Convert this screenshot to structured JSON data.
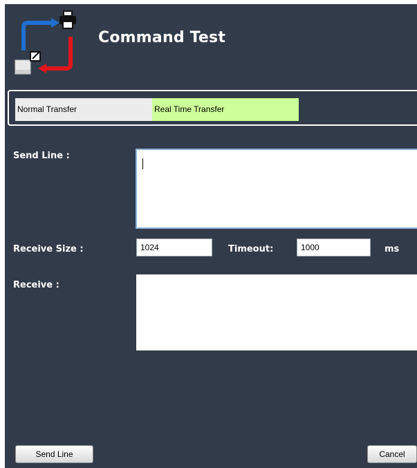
{
  "header": {
    "title": "Command Test",
    "logo_icon": "command-transfer-logo-icon"
  },
  "tabs": [
    {
      "label": "Normal Transfer",
      "selected": false
    },
    {
      "label": "Real Time Transfer",
      "selected": true,
      "color": "#ccff99"
    }
  ],
  "form": {
    "send_line_label": "Send Line :",
    "send_line_value": "",
    "receive_size_label": "Receive Size :",
    "receive_size_value": "1024",
    "timeout_label": "Timeout:",
    "timeout_value": "1000",
    "timeout_unit": "ms",
    "receive_label": "Receive :",
    "receive_value": ""
  },
  "buttons": {
    "send_line": "Send Line",
    "cancel": "Cancel"
  },
  "colors": {
    "background": "#323b4a",
    "active_tab": "#ccff99",
    "arrow_blue": "#1f6fd1",
    "arrow_red": "#e0161b"
  }
}
